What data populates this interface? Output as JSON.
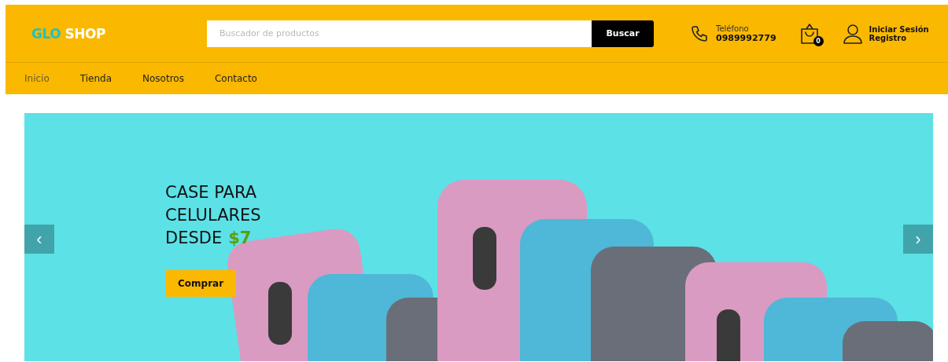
{
  "logo": {
    "first": "GLO",
    "second": "SHOP"
  },
  "search": {
    "placeholder": "Buscador de productos",
    "button": "Buscar"
  },
  "phone": {
    "label": "Teléfono",
    "number": "0989992779"
  },
  "cart": {
    "count": "0"
  },
  "account": {
    "login": "Iniciar Sesión",
    "register": "Registro"
  },
  "nav": [
    {
      "label": "Inicio",
      "selected": true
    },
    {
      "label": "Tienda",
      "selected": false
    },
    {
      "label": "Nosotros",
      "selected": false
    },
    {
      "label": "Contacto",
      "selected": false
    }
  ],
  "hero": {
    "headline": "CASE PARA CELULARES DESDE",
    "price": "$7",
    "button": "Comprar",
    "prev": "‹",
    "next": "›"
  }
}
